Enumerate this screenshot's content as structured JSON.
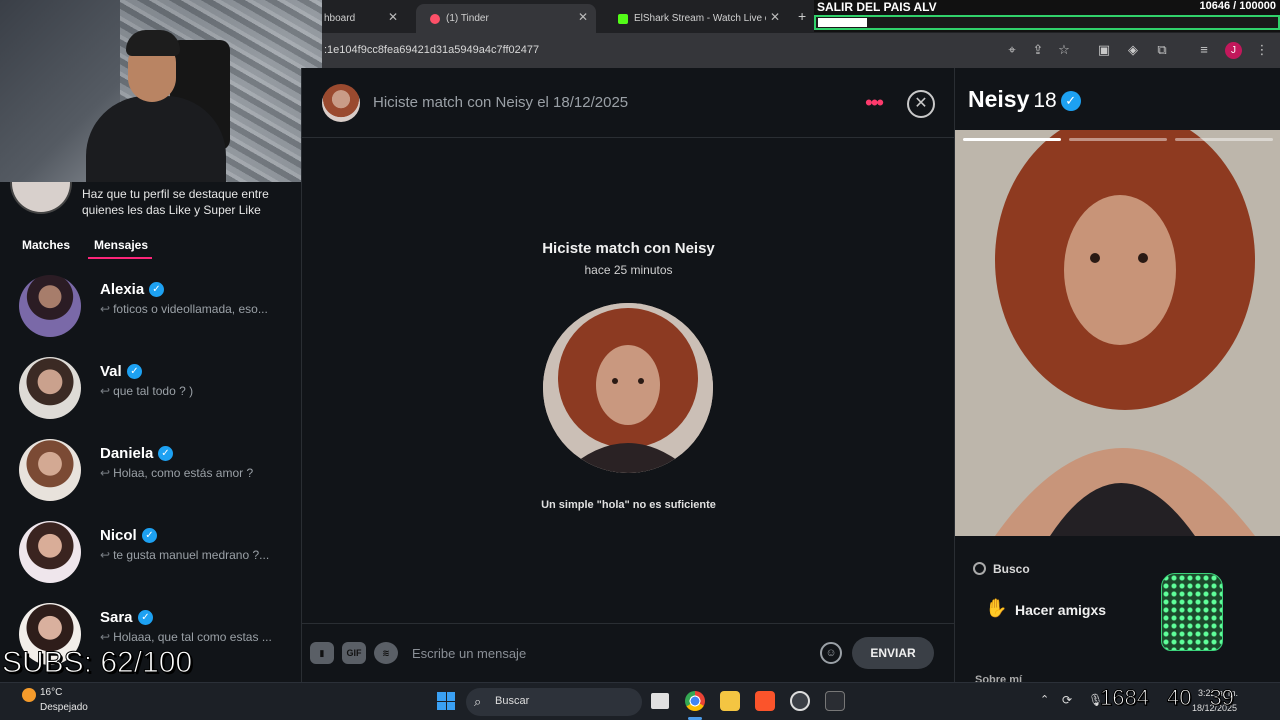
{
  "browser": {
    "tabs": [
      {
        "label": "hboard",
        "icon": "dashboard-icon"
      },
      {
        "label": "(1) Tinder",
        "icon": "tinder-icon"
      },
      {
        "label": "ElShark Stream - Watch Live on",
        "icon": "kick-icon"
      }
    ],
    "url": ":1e104f9cc8fea69421d31a5949a4c7ff02477"
  },
  "goal": {
    "title": "SALIR DEL PAIS ALV",
    "count": "10646  / 100000",
    "progress_fraction": 0.106
  },
  "left_panel": {
    "promo_text": "Haz que tu perfil se destaque entre quienes les das Like y Super Like",
    "tabs": {
      "matches": "Matches",
      "mensajes": "Mensajes"
    },
    "conversations": [
      {
        "name": "Alexia",
        "message": "foticos o videollamada, eso...",
        "verified": true
      },
      {
        "name": "Val",
        "message": "que tal todo ? )",
        "verified": true
      },
      {
        "name": "Daniela",
        "message": "Holaa, como estás amor ?",
        "verified": true
      },
      {
        "name": "Nicol",
        "message": "te gusta manuel medrano ?...",
        "verified": true
      },
      {
        "name": "Sara",
        "message": "Holaaa, que tal como estas ...",
        "verified": true
      }
    ]
  },
  "chat": {
    "header_text": "Hiciste match con Neisy el 18/12/2025",
    "match_title_prefix": "Hiciste match con ",
    "match_name": "Neisy",
    "match_time": "hace 25 minutos",
    "hint": "Un simple \"hola\" no es suficiente",
    "composer": {
      "gif_label": "GIF",
      "placeholder": "Escribe un mensaje",
      "send_label": "ENVIAR"
    }
  },
  "profile": {
    "name": "Neisy",
    "age": "18",
    "busco_label": "Busco",
    "looking_for": "Hacer amigxs",
    "section_label": "Sobre mí",
    "photo_count": 3,
    "active_photo": 1
  },
  "overlay": {
    "subs": "SUBS: 62/100",
    "timer": [
      "1684",
      "40",
      "39"
    ]
  },
  "taskbar": {
    "weather_temp": "16°C",
    "weather_desc": "Despejado",
    "search_label": "Buscar",
    "time": "3:22 a. m.",
    "date": "18/12/2025"
  }
}
